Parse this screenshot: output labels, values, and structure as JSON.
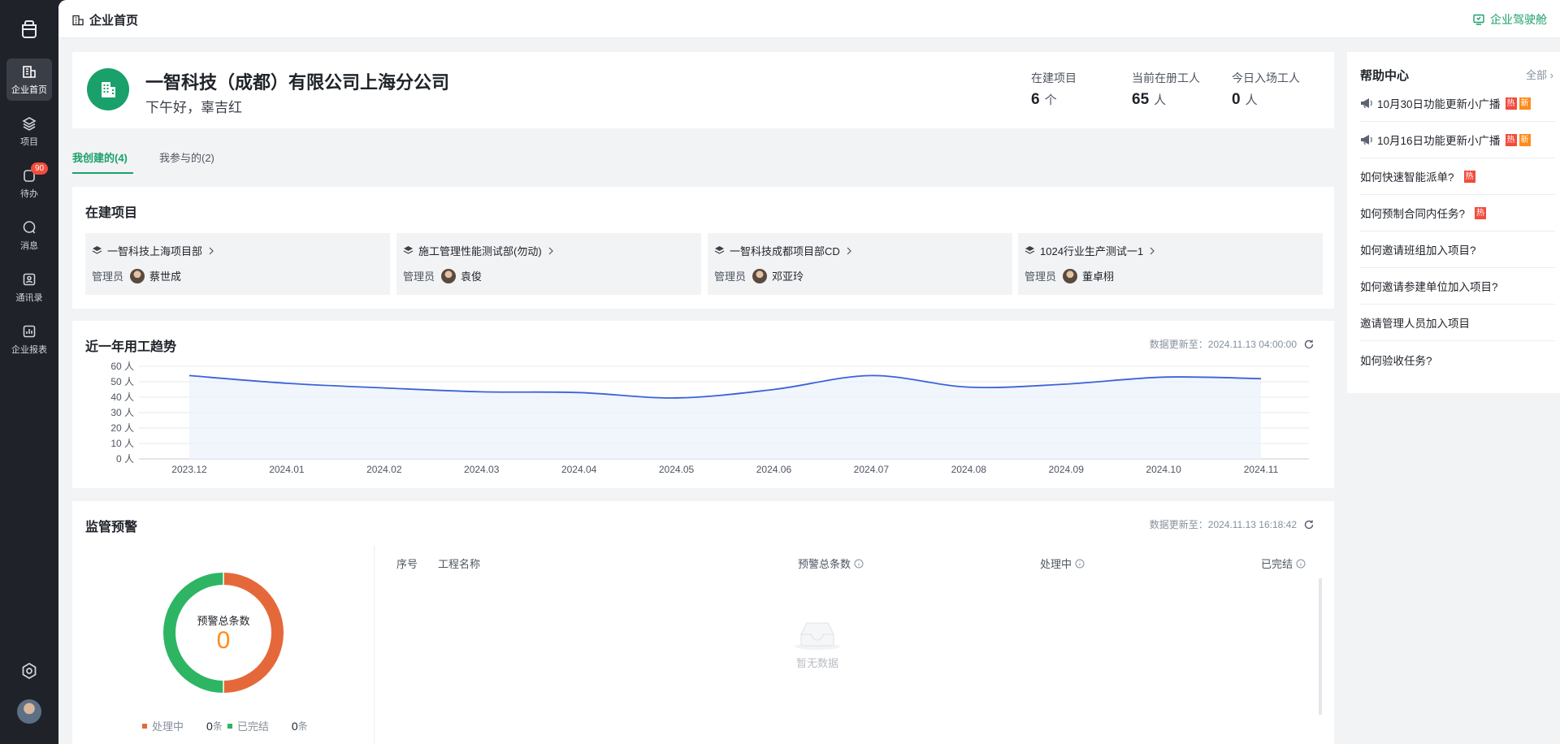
{
  "topbar": {
    "breadcrumb": "企业首页",
    "cockpit": "企业驾驶舱"
  },
  "sidebar": {
    "items": [
      {
        "label": "企业首页",
        "icon": "building-icon",
        "active": true
      },
      {
        "label": "项目",
        "icon": "layers-icon"
      },
      {
        "label": "待办",
        "icon": "todo-icon",
        "badge": "90"
      },
      {
        "label": "消息",
        "icon": "message-icon"
      },
      {
        "label": "通讯录",
        "icon": "contacts-icon"
      },
      {
        "label": "企业报表",
        "icon": "report-icon"
      }
    ]
  },
  "company": {
    "name": "一智科技（成都）有限公司上海分公司",
    "greeting": "下午好，辜吉红",
    "stats": [
      {
        "label": "在建项目",
        "value": "6",
        "unit": "个"
      },
      {
        "label": "当前在册工人",
        "value": "65",
        "unit": "人"
      },
      {
        "label": "今日入场工人",
        "value": "0",
        "unit": "人"
      }
    ]
  },
  "tabs": [
    {
      "label": "我创建的(4)",
      "active": true
    },
    {
      "label": "我参与的(2)"
    }
  ],
  "projects": {
    "title": "在建项目",
    "manager_label": "管理员",
    "items": [
      {
        "name": "一智科技上海项目部",
        "manager": "蔡世成"
      },
      {
        "name": "施工管理性能测试部(勿动)",
        "manager": "袁俊"
      },
      {
        "name": "一智科技成都项目部CD",
        "manager": "邓亚玲"
      },
      {
        "name": "1024行业生产测试一1",
        "manager": "董卓栩"
      }
    ]
  },
  "trend": {
    "title": "近一年用工趋势",
    "updated": "数据更新至：2024.11.13 04:00:00"
  },
  "chart_data": {
    "type": "area",
    "title": "近一年用工趋势",
    "categories": [
      "2023.12",
      "2024.01",
      "2024.02",
      "2024.03",
      "2024.04",
      "2024.05",
      "2024.06",
      "2024.07",
      "2024.08",
      "2024.09",
      "2024.10",
      "2024.11"
    ],
    "series": [
      {
        "values": [
          54,
          49,
          46,
          43.5,
          43,
          39.5,
          45,
          54,
          46.5,
          48.5,
          53,
          52
        ]
      }
    ],
    "y_ticks": [
      "0 人",
      "10 人",
      "20 人",
      "30 人",
      "40 人",
      "50 人",
      "60 人"
    ],
    "ylim": [
      0,
      60
    ],
    "grid": true,
    "color": "#3b63d9"
  },
  "warning": {
    "title": "监管预警",
    "updated": "数据更新至：2024.11.13 16:18:42",
    "donut_label": "预警总条数",
    "donut_total": "0",
    "legend": [
      {
        "label": "处理中",
        "count": "0",
        "unit": "条",
        "color": "#e5683a"
      },
      {
        "label": "已完结",
        "count": "0",
        "unit": "条",
        "color": "#2db563"
      }
    ],
    "columns": [
      "序号",
      "工程名称",
      "预警总条数",
      "处理中",
      "已完结"
    ],
    "empty_text": "暂无数据"
  },
  "help": {
    "title": "帮助中心",
    "all_label": "全部",
    "items": [
      {
        "text": "10月30日功能更新小广播",
        "hot": "热",
        "new": "新"
      },
      {
        "text": "10月16日功能更新小广播",
        "hot": "热",
        "new": "新"
      },
      {
        "text": "如何快速智能派单?",
        "hot": "热"
      },
      {
        "text": "如何预制合同内任务?",
        "hot": "热"
      },
      {
        "text": "如何邀请班组加入项目?"
      },
      {
        "text": "如何邀请参建单位加入项目?"
      },
      {
        "text": "邀请管理人员加入项目"
      },
      {
        "text": "如何验收任务?"
      }
    ]
  }
}
